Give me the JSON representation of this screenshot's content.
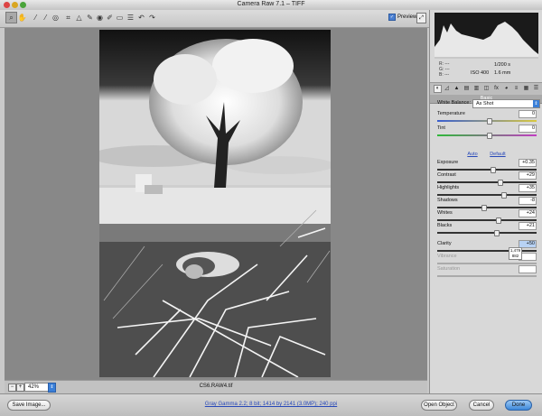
{
  "window": {
    "title": "Camera Raw 7.1  –  TIFF"
  },
  "toolbar": {
    "tools": [
      "zoom-tool-icon",
      "hand-tool-icon",
      "white-balance-tool-icon",
      "color-sampler-tool-icon",
      "targeted-adjustment-tool-icon",
      "crop-tool-icon",
      "straighten-tool-icon",
      "spot-removal-tool-icon",
      "red-eye-removal-tool-icon",
      "adjustment-brush-icon",
      "graduated-filter-icon",
      "preferences-icon",
      "rotate-ccw-icon",
      "rotate-cw-icon"
    ],
    "preview_label": "Preview"
  },
  "canvas": {
    "zoom": "42%",
    "filename": "CS6.RAW4.tif"
  },
  "histogram": {
    "rgb_labels": [
      "R: ---",
      "G: ---",
      "B: ---"
    ],
    "shutter": "1/200 s",
    "iso": "ISO 400",
    "focal": "1.6 mm"
  },
  "panel": {
    "section_title": "Basic",
    "white_balance_label": "White Balance:",
    "white_balance_value": "As Shot",
    "auto_label": "Auto",
    "default_label": "Default",
    "sliders": [
      {
        "label": "Temperature",
        "value": "0",
        "pos": 0.52
      },
      {
        "label": "Tint",
        "value": "0",
        "pos": 0.52
      },
      {
        "label": "Exposure",
        "value": "+0.35",
        "pos": 0.55
      },
      {
        "label": "Contrast",
        "value": "+29",
        "pos": 0.63
      },
      {
        "label": "Highlights",
        "value": "+35",
        "pos": 0.66
      },
      {
        "label": "Shadows",
        "value": "-8",
        "pos": 0.46
      },
      {
        "label": "Whites",
        "value": "+24",
        "pos": 0.61
      },
      {
        "label": "Blacks",
        "value": "+21",
        "pos": 0.59
      },
      {
        "label": "Clarity",
        "value": "+50",
        "pos": 0.75
      },
      {
        "label": "Vibrance",
        "value": "",
        "pos": 0.5
      },
      {
        "label": "Saturation",
        "value": "",
        "pos": 0.5
      }
    ],
    "tooltip": {
      "line1": "1,479",
      "line2": "882"
    }
  },
  "bottom": {
    "save_label": "Save Image...",
    "workflow_link": "Gray Gamma 2.2; 8 bit; 1414 by 2141 (3.0MP); 240 ppi",
    "open_label": "Open Object",
    "cancel_label": "Cancel",
    "done_label": "Done"
  },
  "colors": {
    "accent": "#3a7fd8",
    "link": "#2748b8",
    "canvas_bg": "#888888"
  }
}
